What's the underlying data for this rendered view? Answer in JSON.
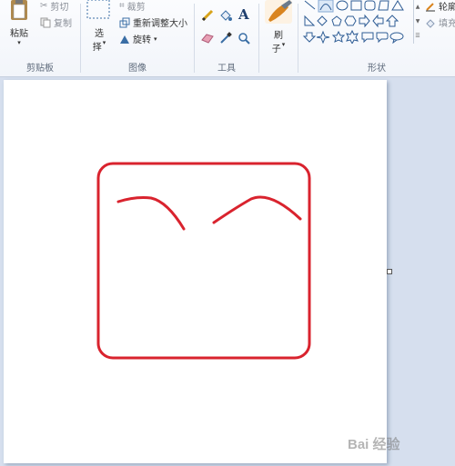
{
  "clipboard": {
    "paste_label": "粘贴",
    "cut_label": "剪切",
    "copy_label": "复制",
    "group_label": "剪贴板"
  },
  "image": {
    "select_label_1": "选",
    "select_label_2": "择",
    "crop_label": "裁剪",
    "resize_label": "重新调整大小",
    "rotate_label": "旋转",
    "group_label": "图像"
  },
  "tools": {
    "text_tool_glyph": "A",
    "group_label": "工具"
  },
  "brushes": {
    "label_1": "刷",
    "label_2": "子",
    "group_label": ""
  },
  "shapes": {
    "outline_label": "轮廓",
    "fill_label": "填充",
    "group_label": "形状"
  },
  "drawing": {
    "stroke_color": "#d9232e"
  },
  "watermark": {
    "text": "Bai 经验"
  }
}
